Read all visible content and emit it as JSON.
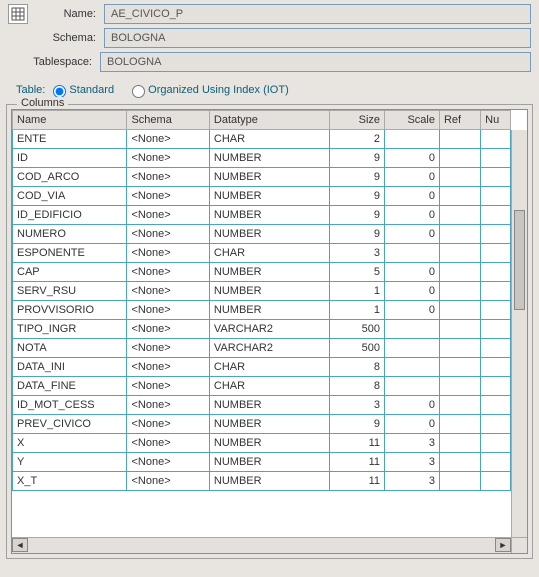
{
  "form": {
    "name_label": "Name:",
    "name_value": "AE_CIVICO_P",
    "schema_label": "Schema:",
    "schema_value": "BOLOGNA",
    "tablespace_label": "Tablespace:",
    "tablespace_value": "BOLOGNA"
  },
  "radio": {
    "table_label": "Table:",
    "standard": "Standard",
    "iot": "Organized Using Index (IOT)"
  },
  "fieldset_title": "Columns",
  "columns": {
    "headers": {
      "name": "Name",
      "schema": "Schema",
      "datatype": "Datatype",
      "size": "Size",
      "scale": "Scale",
      "ref": "Ref",
      "nu": "Nu"
    },
    "rows": [
      {
        "name": "ENTE",
        "schema": "<None>",
        "datatype": "CHAR",
        "size": "2",
        "scale": "",
        "ref": "",
        "nu": ""
      },
      {
        "name": "ID",
        "schema": "<None>",
        "datatype": "NUMBER",
        "size": "9",
        "scale": "0",
        "ref": "",
        "nu": ""
      },
      {
        "name": "COD_ARCO",
        "schema": "<None>",
        "datatype": "NUMBER",
        "size": "9",
        "scale": "0",
        "ref": "",
        "nu": ""
      },
      {
        "name": "COD_VIA",
        "schema": "<None>",
        "datatype": "NUMBER",
        "size": "9",
        "scale": "0",
        "ref": "",
        "nu": ""
      },
      {
        "name": "ID_EDIFICIO",
        "schema": "<None>",
        "datatype": "NUMBER",
        "size": "9",
        "scale": "0",
        "ref": "",
        "nu": ""
      },
      {
        "name": "NUMERO",
        "schema": "<None>",
        "datatype": "NUMBER",
        "size": "9",
        "scale": "0",
        "ref": "",
        "nu": ""
      },
      {
        "name": "ESPONENTE",
        "schema": "<None>",
        "datatype": "CHAR",
        "size": "3",
        "scale": "",
        "ref": "",
        "nu": ""
      },
      {
        "name": "CAP",
        "schema": "<None>",
        "datatype": "NUMBER",
        "size": "5",
        "scale": "0",
        "ref": "",
        "nu": ""
      },
      {
        "name": "SERV_RSU",
        "schema": "<None>",
        "datatype": "NUMBER",
        "size": "1",
        "scale": "0",
        "ref": "",
        "nu": ""
      },
      {
        "name": "PROVVISORIO",
        "schema": "<None>",
        "datatype": "NUMBER",
        "size": "1",
        "scale": "0",
        "ref": "",
        "nu": ""
      },
      {
        "name": "TIPO_INGR",
        "schema": "<None>",
        "datatype": "VARCHAR2",
        "size": "500",
        "scale": "",
        "ref": "",
        "nu": ""
      },
      {
        "name": "NOTA",
        "schema": "<None>",
        "datatype": "VARCHAR2",
        "size": "500",
        "scale": "",
        "ref": "",
        "nu": ""
      },
      {
        "name": "DATA_INI",
        "schema": "<None>",
        "datatype": "CHAR",
        "size": "8",
        "scale": "",
        "ref": "",
        "nu": ""
      },
      {
        "name": "DATA_FINE",
        "schema": "<None>",
        "datatype": "CHAR",
        "size": "8",
        "scale": "",
        "ref": "",
        "nu": ""
      },
      {
        "name": "ID_MOT_CESS",
        "schema": "<None>",
        "datatype": "NUMBER",
        "size": "3",
        "scale": "0",
        "ref": "",
        "nu": ""
      },
      {
        "name": "PREV_CIVICO",
        "schema": "<None>",
        "datatype": "NUMBER",
        "size": "9",
        "scale": "0",
        "ref": "",
        "nu": ""
      },
      {
        "name": "X",
        "schema": "<None>",
        "datatype": "NUMBER",
        "size": "11",
        "scale": "3",
        "ref": "",
        "nu": ""
      },
      {
        "name": "Y",
        "schema": "<None>",
        "datatype": "NUMBER",
        "size": "11",
        "scale": "3",
        "ref": "",
        "nu": ""
      },
      {
        "name": "X_T",
        "schema": "<None>",
        "datatype": "NUMBER",
        "size": "11",
        "scale": "3",
        "ref": "",
        "nu": ""
      }
    ]
  }
}
